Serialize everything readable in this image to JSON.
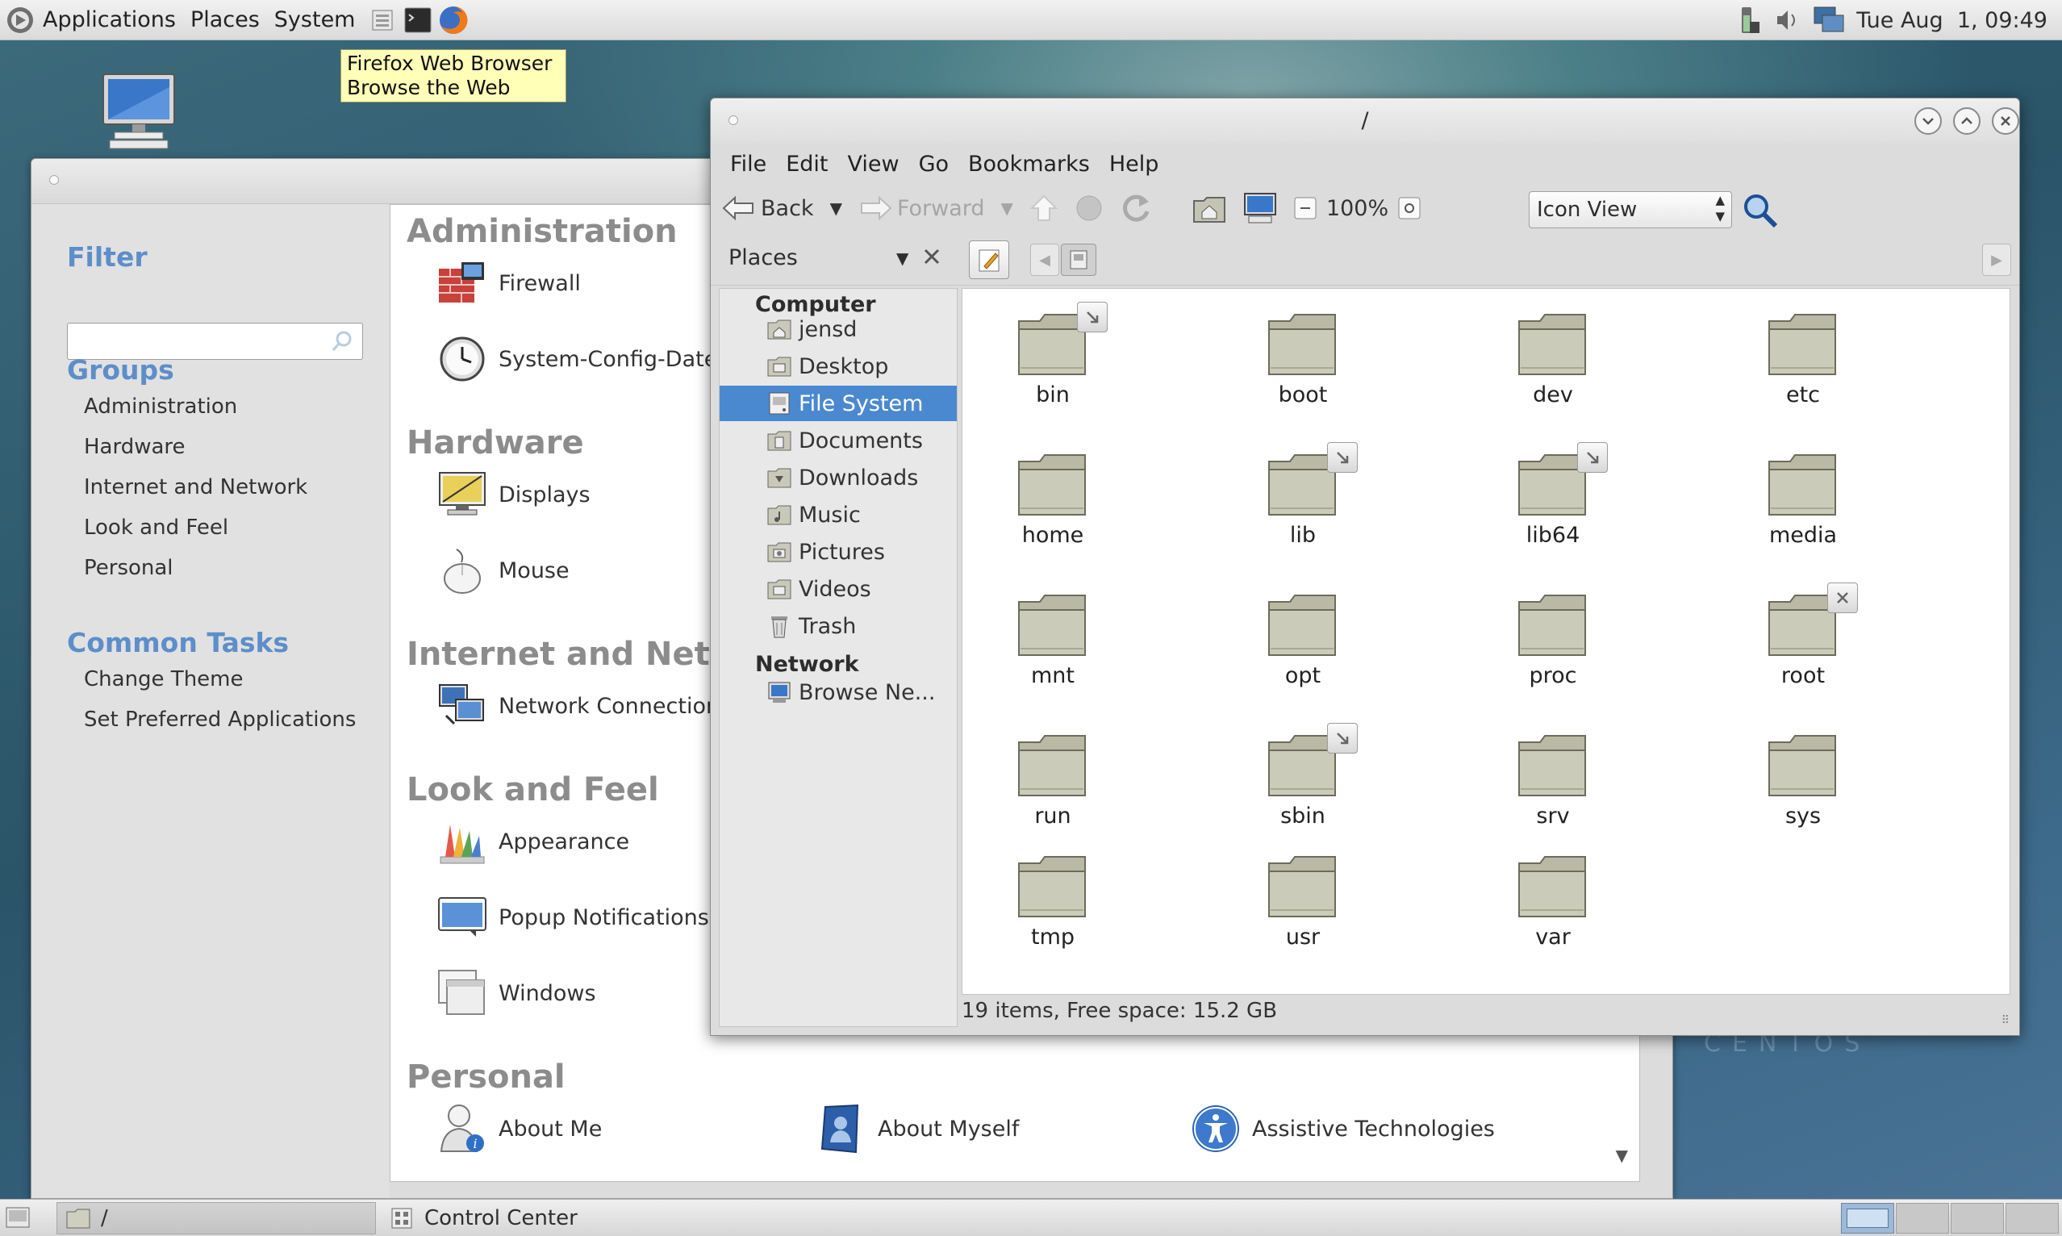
{
  "top_panel": {
    "menus": [
      "Applications",
      "Places",
      "System"
    ],
    "launchers": [
      "file-manager-icon",
      "terminal-icon",
      "firefox-icon"
    ],
    "clock": "Tue Aug  1, 09:49"
  },
  "tooltip": {
    "line1": "Firefox Web Browser",
    "line2": "Browse the Web"
  },
  "control_center": {
    "filter_label": "Filter",
    "filter_value": "",
    "groups_label": "Groups",
    "groups": [
      "Administration",
      "Hardware",
      "Internet and Network",
      "Look and Feel",
      "Personal"
    ],
    "common_tasks_label": "Common Tasks",
    "common_tasks": [
      "Change Theme",
      "Set Preferred Applications"
    ],
    "categories": {
      "administration": "Administration",
      "hardware": "Hardware",
      "internet": "Internet and Network",
      "look": "Look and Feel",
      "personal": "Personal"
    },
    "items": {
      "firewall": "Firewall",
      "date": "System-Config-Date",
      "displays": "Displays",
      "mouse": "Mouse",
      "network": "Network Connections",
      "appearance": "Appearance",
      "popup": "Popup Notifications",
      "windows": "Windows",
      "about_me": "About Me",
      "about_myself": "About Myself",
      "assistive": "Assistive Technologies"
    }
  },
  "file_manager": {
    "title": "/",
    "menu": [
      "File",
      "Edit",
      "View",
      "Go",
      "Bookmarks",
      "Help"
    ],
    "toolbar": {
      "back": "Back",
      "forward": "Forward",
      "zoom": "100%",
      "view_mode": "Icon View"
    },
    "places_label": "Places",
    "sidebar": {
      "computer_header": "Computer",
      "computer_items": [
        "jensd",
        "Desktop",
        "File System",
        "Documents",
        "Downloads",
        "Music",
        "Pictures",
        "Videos",
        "Trash"
      ],
      "selected": "File System",
      "network_header": "Network",
      "network_items": [
        "Browse Ne..."
      ]
    },
    "folders": [
      "bin",
      "boot",
      "dev",
      "etc",
      "home",
      "lib",
      "lib64",
      "media",
      "mnt",
      "opt",
      "proc",
      "root",
      "run",
      "sbin",
      "srv",
      "sys",
      "tmp",
      "usr",
      "var"
    ],
    "status": "19 items, Free space: 15.2 GB"
  },
  "bottom_panel": {
    "tasks": [
      {
        "label": "/"
      },
      {
        "label": "Control Center"
      }
    ]
  },
  "desktop_watermark": "CENTOS"
}
